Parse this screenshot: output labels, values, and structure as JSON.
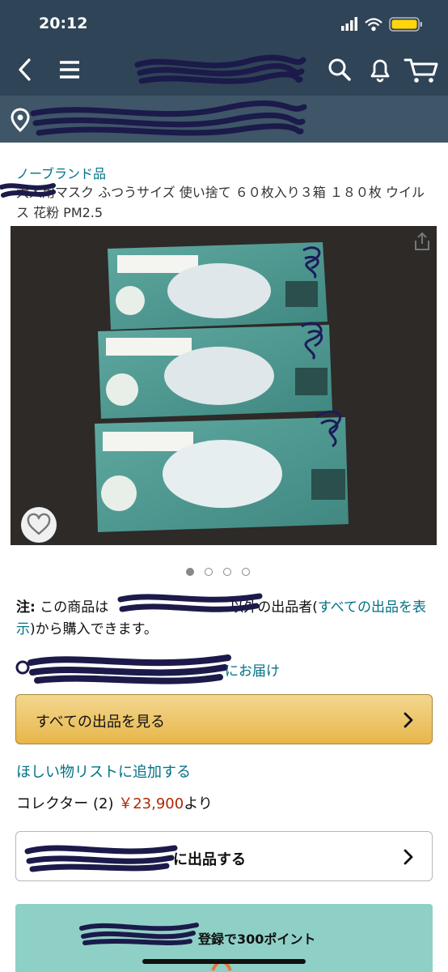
{
  "status": {
    "time": "20:12"
  },
  "product": {
    "brand": "ノーブランド品",
    "title": "大人用マスク ふつうサイズ 使い捨て ６０枚入り３箱 １８０枚 ウイルス 花粉 PM2.5"
  },
  "carousel": {
    "page_count": 4,
    "active_index": 0
  },
  "note": {
    "label": "注:",
    "text_before": "この商品は",
    "text_mid": "以外の出品者(",
    "link": "すべての出品を表示",
    "text_after": ")から購入できます。"
  },
  "delivery": {
    "link": "にお届け"
  },
  "buttons": {
    "see_all_offers": "すべての出品を見る",
    "add_to_wishlist": "ほしい物リストに追加する",
    "sell": "に出品する"
  },
  "collector": {
    "label": "コレクター (2)",
    "price": "￥23,900",
    "suffix": "より"
  },
  "banner": {
    "text": "登録で300ポイント"
  },
  "colors": {
    "header_bg": "#2f4456",
    "address_bg": "#3e5668",
    "link": "#007185",
    "price": "#b12704",
    "button_yellow": "#f0c14b"
  },
  "icons": [
    "back-icon",
    "menu-icon",
    "search-icon",
    "bell-icon",
    "cart-icon",
    "location-pin-icon",
    "heart-icon",
    "share-icon",
    "chevron-right-icon"
  ]
}
